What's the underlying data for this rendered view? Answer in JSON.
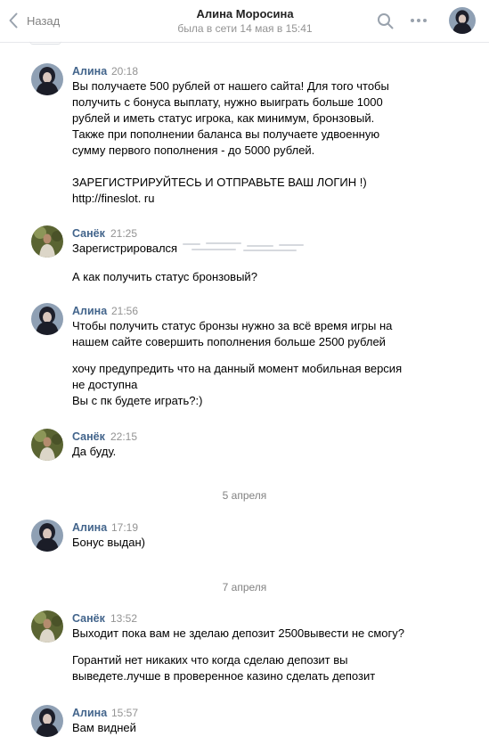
{
  "header": {
    "back_label": "Назад",
    "name": "Алина Моросина",
    "status": "была в сети 14 мая в 15:41"
  },
  "icons": {
    "back": "chevron-left-icon",
    "search": "search-icon",
    "more": "more-horizontal-icon"
  },
  "colors": {
    "author": "#42648b",
    "meta": "#939393",
    "icon": "#99a2ad"
  },
  "messages": [
    {
      "author": "Алина",
      "time": "20:18",
      "lines": [
        "Вы получаете 500 рублей от нашего сайта! Для того чтобы",
        "получить с бонуса выплату, нужно выиграть больше 1000",
        "рублей и иметь статус игрока, как минимум, бронзовый.",
        "Также при пополнении баланса вы получаете удвоенную",
        "сумму первого пополнения - до 5000 рублей.",
        "ЗАРЕГИСТРИРУЙТЕСЬ И ОТПРАВЬТЕ ВАШ ЛОГИН !)",
        "http://fineslot. ru"
      ]
    },
    {
      "author": "Санёк",
      "time": "21:25",
      "lines": [
        "Зарегистрировался",
        "А как получить статус бронзовый?"
      ]
    },
    {
      "author": "Алина",
      "time": "21:56",
      "lines": [
        "Чтобы получить статус бронзы нужно за всё время игры на",
        "нашем сайте совершить пополнения больше 2500 рублей",
        "хочу предупредить что на данный момент мобильная версия",
        "не доступна",
        "Вы с пк будете играть?:)"
      ]
    },
    {
      "author": "Санёк",
      "time": "22:15",
      "lines": [
        "Да буду."
      ]
    },
    {
      "author": "Алина",
      "time": "17:19",
      "lines": [
        "Бонус выдан)"
      ]
    },
    {
      "author": "Санёк",
      "time": "13:52",
      "lines": [
        "Выходит пока вам не зделаю депозит 2500вывести не смогу?",
        "Горантий нет никаких что когда сделаю депозит вы",
        "выведете.лучше в проверенное казино сделать депозит"
      ]
    },
    {
      "author": "Алина",
      "time": "15:57",
      "lines": [
        "Вам видней"
      ]
    }
  ],
  "date_separators": [
    "5 апреля",
    "7 апреля"
  ]
}
